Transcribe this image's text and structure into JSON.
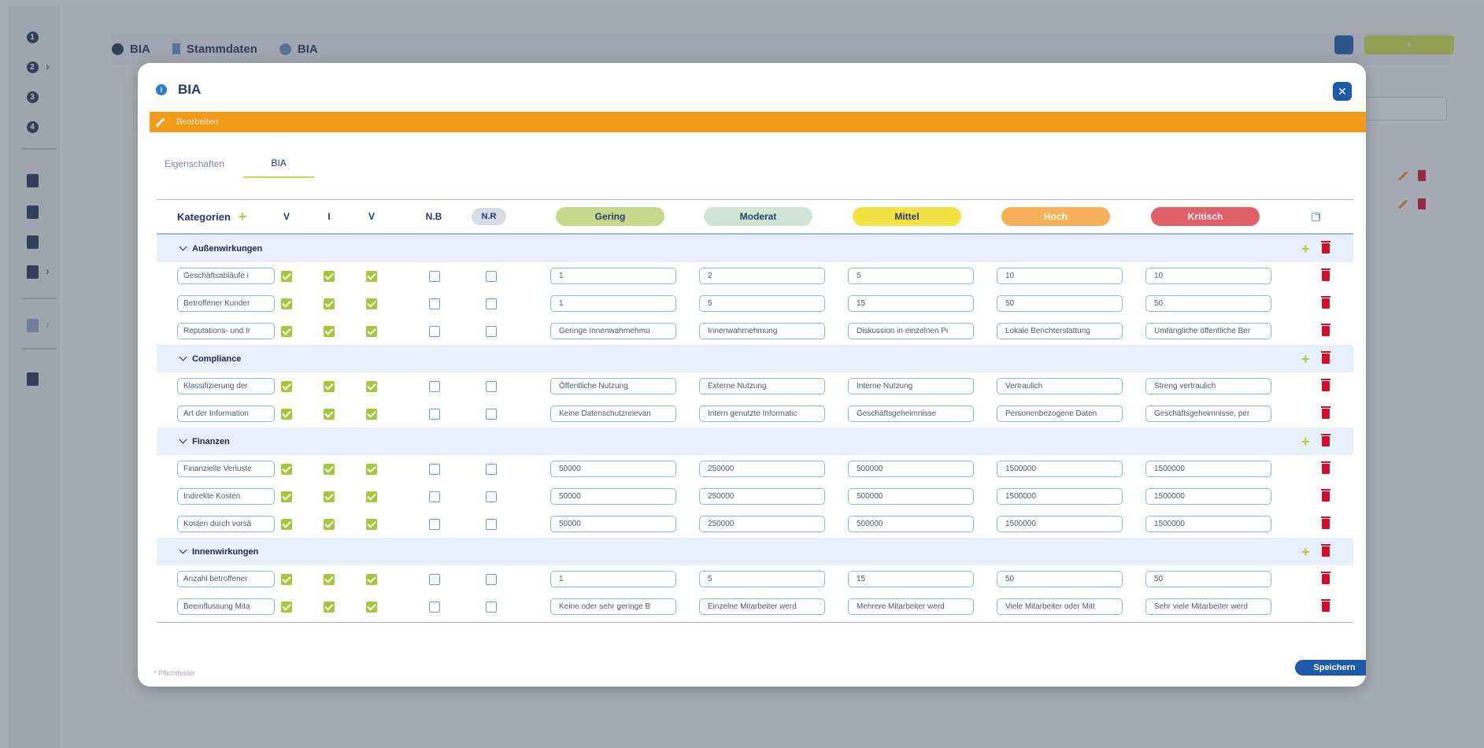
{
  "breadcrumb": [
    {
      "label": "BIA"
    },
    {
      "label": "Stammdaten"
    },
    {
      "label": "BIA"
    }
  ],
  "sidebar": {
    "numbered_items": [
      "1",
      "2",
      "3",
      "4"
    ]
  },
  "modal": {
    "title": "BIA",
    "mode_label": "Bearbeiten",
    "close_icon": "close-icon",
    "tabs": [
      {
        "label": "Eigenschaften",
        "active": false
      },
      {
        "label": "BIA",
        "active": true
      }
    ],
    "columns": {
      "kategorien": "Kategorien",
      "v1": "V",
      "i": "I",
      "v2": "V",
      "nb": "N.B",
      "nr": "N.R",
      "levels": [
        "Gering",
        "Moderat",
        "Mittel",
        "Hoch",
        "Kritisch"
      ]
    },
    "groups": [
      {
        "name": "Außenwirkungen",
        "rows": [
          {
            "name": "Geschäftsabläufe i",
            "checks": [
              true,
              true,
              true,
              false,
              false
            ],
            "levels": [
              "1",
              "2",
              "5",
              "10",
              "10"
            ]
          },
          {
            "name": "Betroffener Kunder",
            "checks": [
              true,
              true,
              true,
              false,
              false
            ],
            "levels": [
              "1",
              "5",
              "15",
              "50",
              "50"
            ]
          },
          {
            "name": "Reputations- und Ir",
            "checks": [
              true,
              true,
              true,
              false,
              false
            ],
            "levels": [
              "Geringe Innenwahrnehmu",
              "Innenwahrnehmung",
              "Diskussion in einzelnen Pi",
              "Lokale Berichterstattung",
              "Umfängliche öffentliche Ber"
            ]
          }
        ]
      },
      {
        "name": "Compliance",
        "rows": [
          {
            "name": "Klassifizierung der",
            "checks": [
              true,
              true,
              true,
              false,
              false
            ],
            "levels": [
              "Öffentliche Nutzung",
              "Externe Nutzung",
              "Interne Nutzung",
              "Vertraulich",
              "Streng vertraulich"
            ]
          },
          {
            "name": "Art der Information",
            "checks": [
              true,
              true,
              true,
              false,
              false
            ],
            "levels": [
              "Keine Datenschutzrelevan",
              "Intern genutzte Informatic",
              "Geschäftsgeheimnisse",
              "Personenbezogene Daten",
              "Geschäftsgeheimnisse, per"
            ]
          }
        ]
      },
      {
        "name": "Finanzen",
        "rows": [
          {
            "name": "Finanzielle Verluste",
            "checks": [
              true,
              true,
              true,
              false,
              false
            ],
            "levels": [
              "50000",
              "250000",
              "500000",
              "1500000",
              "1500000"
            ]
          },
          {
            "name": "Indirekte Kosten",
            "checks": [
              true,
              true,
              true,
              false,
              false
            ],
            "levels": [
              "50000",
              "250000",
              "500000",
              "1500000",
              "1500000"
            ]
          },
          {
            "name": "Kosten durch vorsä",
            "checks": [
              true,
              true,
              true,
              false,
              false
            ],
            "levels": [
              "50000",
              "250000",
              "500000",
              "1500000",
              "1500000"
            ]
          }
        ]
      },
      {
        "name": "Innenwirkungen",
        "rows": [
          {
            "name": "Anzahl betroffener",
            "checks": [
              true,
              true,
              true,
              false,
              false
            ],
            "levels": [
              "1",
              "5",
              "15",
              "50",
              "50"
            ]
          },
          {
            "name": "Beeinflussung Mita",
            "checks": [
              true,
              true,
              true,
              false,
              false
            ],
            "levels": [
              "Keine oder sehr geringe B",
              "Einzelne Mitarbeiter werd",
              "Mehrere Mitarbeiter werd",
              "Viele Mitarbeiter oder Mitt",
              "Sehr viele Mitarbeiter werd"
            ]
          }
        ]
      }
    ],
    "footnote": "* Pflichtfelder",
    "save_label": "Speichern"
  },
  "colors": {
    "primary": "#1d5aa8",
    "accent_green": "#c8d64a",
    "edit_orange": "#f29a1c",
    "delete_red": "#d0102a",
    "level_geringe": "#c8d88a",
    "level_moderat": "#cfe4d4",
    "level_mittel": "#f4e244",
    "level_hoch": "#f6b159",
    "level_kritisch": "#e2606a"
  }
}
